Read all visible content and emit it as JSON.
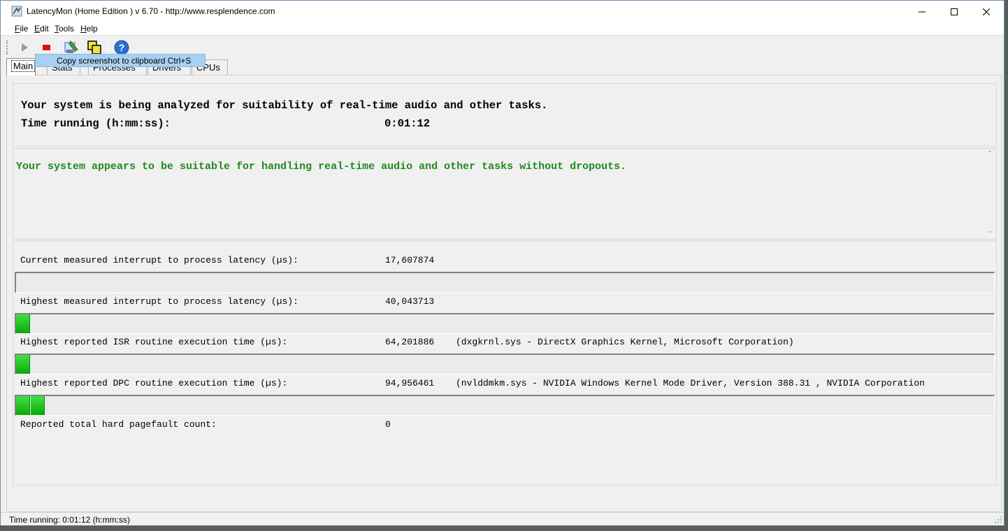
{
  "window": {
    "title": "LatencyMon  (Home Edition )  v 6.70 - http://www.resplendence.com"
  },
  "menu": [
    "File",
    "Edit",
    "Tools",
    "Help"
  ],
  "toolbar": {
    "buttons": [
      "play-icon",
      "stop-icon",
      "screenshot-icon",
      "copy-icon",
      "help-icon"
    ],
    "tooltip": "Copy screenshot to clipboard Ctrl+S"
  },
  "tabs": [
    "Main",
    "Stats",
    "Processes",
    "Drivers",
    "CPUs"
  ],
  "main": {
    "analysis_line": "Your system is being analyzed for suitability of real-time audio and other tasks.",
    "time_label": "Time running (h:mm:ss):",
    "time_value": "0:01:12",
    "verdict": "Your system appears to be suitable for handling real-time audio and other tasks without dropouts.",
    "verdict_color": "#1f8a1f",
    "rows": [
      {
        "label": "Current measured interrupt to process latency (µs):",
        "value": "17,607874",
        "extra": "",
        "bar_segments": 0
      },
      {
        "label": "Highest measured interrupt to process latency (µs):",
        "value": "40,043713",
        "extra": "",
        "bar_segments": 1
      },
      {
        "label": "Highest reported ISR routine execution time (µs):",
        "value": "64,201886",
        "extra": "(dxgkrnl.sys - DirectX Graphics Kernel, Microsoft Corporation)",
        "bar_segments": 1
      },
      {
        "label": "Highest reported DPC routine execution time (µs):",
        "value": "94,956461",
        "extra": "(nvlddmkm.sys - NVIDIA Windows Kernel Mode Driver, Version 388.31 , NVIDIA Corporation",
        "bar_segments": 2
      },
      {
        "label": "Reported total hard pagefault count:",
        "value": "0",
        "extra": ""
      }
    ]
  },
  "status": {
    "text": "Time running: 0:01:12  (h:mm:ss)"
  },
  "colors": {
    "bar_green": "#22c022",
    "window_bg": "#f0f0f0"
  }
}
